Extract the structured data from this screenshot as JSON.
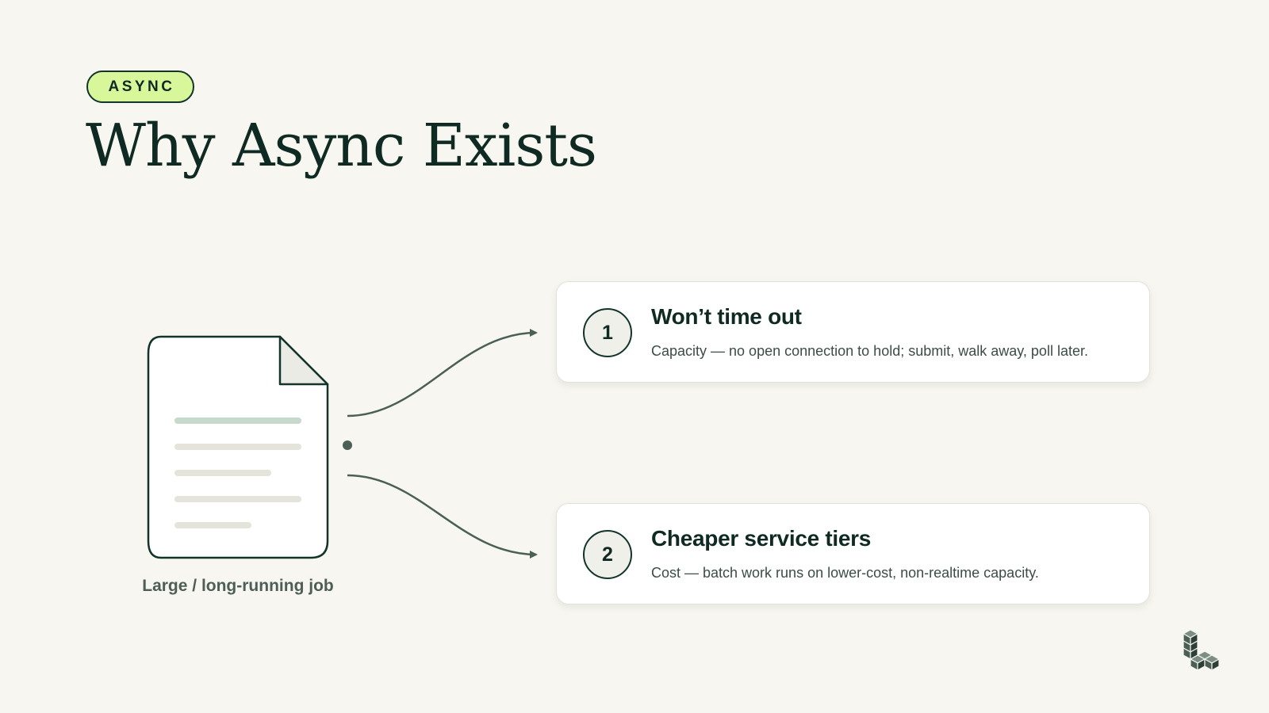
{
  "badge": {
    "label": "ASYNC"
  },
  "title": "Why Async Exists",
  "job": {
    "label": "Large / long-running job"
  },
  "cards": [
    {
      "number": "1",
      "title": "Won’t time out",
      "description": "Capacity — no open connection to hold; submit, walk away, poll later."
    },
    {
      "number": "2",
      "title": "Cheaper service tiers",
      "description": "Cost — batch work runs on lower-cost, non-realtime capacity."
    }
  ],
  "colors": {
    "background": "#f7f6f0",
    "badge": "#d8f79a",
    "ink": "#0f2a22",
    "connector": "#4a5f55",
    "card": "#ffffff",
    "number_circle": "#eef0e9"
  },
  "icons": {
    "document": "document-icon",
    "logo": "stacked-cubes-logo"
  }
}
